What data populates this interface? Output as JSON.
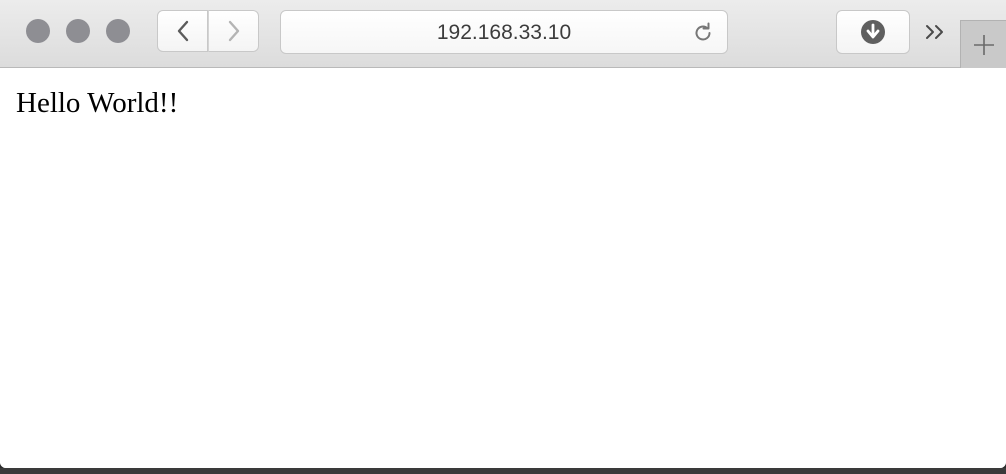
{
  "browser": {
    "address_bar": {
      "url": "192.168.33.10"
    },
    "icons": {
      "back": "chevron-left-icon",
      "forward": "chevron-right-icon",
      "reload": "reload-icon",
      "download": "download-icon",
      "more": "double-chevron-right-icon",
      "new_tab": "plus-icon"
    },
    "colors": {
      "traffic_lights": "#8e8e93",
      "toolbar": "#e2e2e2"
    }
  },
  "page": {
    "text": "Hello World!!"
  }
}
